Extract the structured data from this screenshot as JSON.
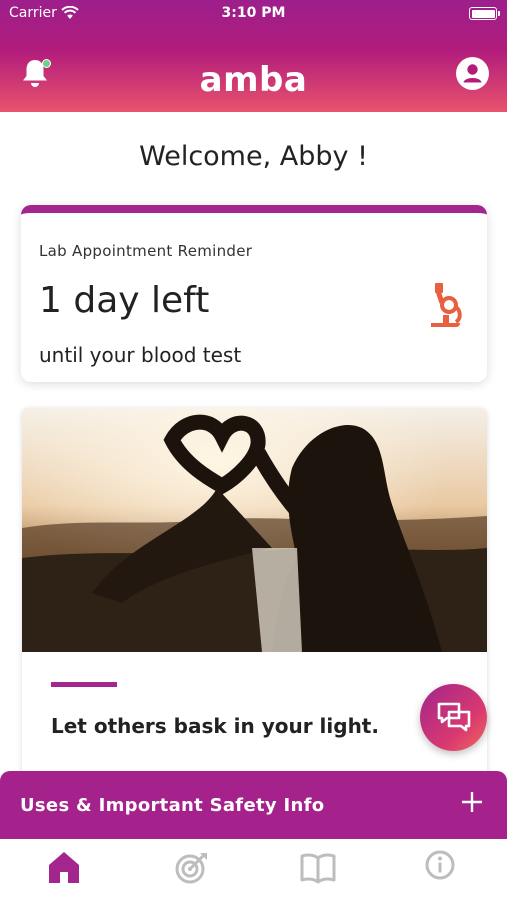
{
  "status_bar": {
    "carrier": "Carrier",
    "time": "3:10 PM"
  },
  "header": {
    "logo_text": "amba",
    "left_icon": "bell-icon",
    "right_icon": "profile-icon"
  },
  "welcome": "Welcome, Abby !",
  "reminder_card": {
    "label": "Lab Appointment Reminder",
    "countdown": "1 day left",
    "subtitle": "until your blood test",
    "icon": "microscope-icon"
  },
  "inspiration_card": {
    "quote": "Let others bask in your light."
  },
  "chat_button": {
    "icon": "chat-bubbles-icon"
  },
  "safety_bar": {
    "label": "Uses & Important Safety Info",
    "icon": "plus-icon"
  },
  "tabbar": {
    "tabs": [
      {
        "icon": "home-icon",
        "active": true
      },
      {
        "icon": "target-icon",
        "active": false
      },
      {
        "icon": "book-icon",
        "active": false
      },
      {
        "icon": "info-icon",
        "active": false
      }
    ]
  },
  "colors": {
    "brand": "#a2268d",
    "header_gradient_start": "#9c1f8c",
    "header_gradient_end": "#e8536d",
    "accent_orange": "#e8603f",
    "inactive_icon": "#bdbdbd"
  }
}
